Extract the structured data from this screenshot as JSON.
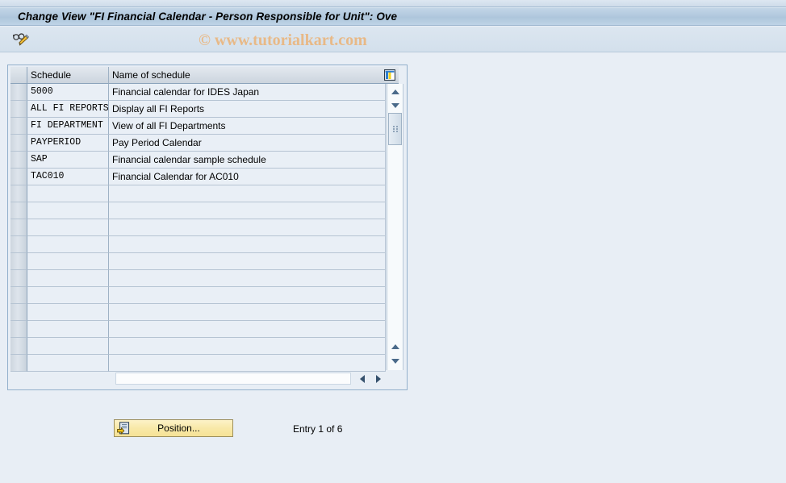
{
  "window": {
    "title": "Change View \"FI Financial Calendar - Person Responsible for Unit\": Ove"
  },
  "toolbar": {
    "display_change_icon": "glasses-pencil-icon",
    "display_change_tooltip": "Display -> Change"
  },
  "watermark": {
    "text": "© www.tutorialkart.com",
    "color": "#e8b987"
  },
  "table": {
    "config_icon": "table-columns-icon",
    "columns": [
      {
        "key": "schedule",
        "label": "Schedule"
      },
      {
        "key": "name",
        "label": "Name of schedule"
      }
    ],
    "rows": [
      {
        "schedule": "5000",
        "name": "Financial calendar for IDES Japan"
      },
      {
        "schedule": "ALL FI REPORTS",
        "name": "Display all FI Reports"
      },
      {
        "schedule": "FI DEPARTMENT",
        "name": "View of all FI Departments"
      },
      {
        "schedule": "PAYPERIOD",
        "name": "Pay Period Calendar"
      },
      {
        "schedule": "SAP",
        "name": "Financial calendar sample schedule"
      },
      {
        "schedule": "TAC010",
        "name": "Financial Calendar for AC010"
      }
    ],
    "empty_row_count": 11,
    "vertical_scrollbar": {
      "up_arrow": "triangle-up-icon",
      "down_arrow": "triangle-down-icon",
      "bottom_up_arrow": "triangle-up-icon",
      "bottom_down_arrow": "triangle-down-icon",
      "thumb": "scroll-thumb"
    },
    "horizontal_scrollbar": {
      "left_arrow_start": "triangle-left-icon",
      "right_arrow_start": "triangle-right-icon",
      "left_arrow_end": "triangle-left-icon",
      "right_arrow_end": "triangle-right-icon"
    }
  },
  "footer": {
    "position_button_label": "Position...",
    "position_button_icon": "position-document-icon",
    "entry_counter": "Entry 1 of 6"
  },
  "colors": {
    "page_background": "#e8eef5",
    "title_bar": "#aec6dc",
    "grid_row": "#e9eff6",
    "button_yellow": "#f6e296"
  }
}
